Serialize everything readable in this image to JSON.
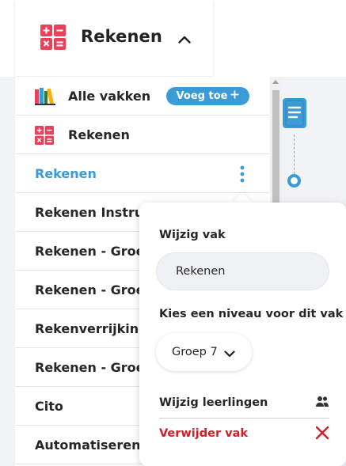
{
  "header": {
    "title": "Rekenen",
    "icon": "math-operators-icon",
    "toggle_icon": "chevron-up-icon"
  },
  "list": {
    "items": [
      {
        "label": "Alle vakken",
        "icon": "books-icon",
        "button": "Voeg toe"
      },
      {
        "label": "Rekenen",
        "icon": "math-operators-icon"
      },
      {
        "label": "Rekenen",
        "active": true,
        "menu_icon": "kebab-icon"
      },
      {
        "label": "Rekenen Instructie"
      },
      {
        "label": "Rekenen - Groep"
      },
      {
        "label": "Rekenen - Groep"
      },
      {
        "label": "Rekenverrijking"
      },
      {
        "label": "Rekenen - Groep"
      },
      {
        "label": "Cito"
      },
      {
        "label": "Automatiseren"
      }
    ]
  },
  "popup": {
    "edit_subject_label": "Wijzig vak",
    "subject_name_value": "Rekenen",
    "level_label": "Kies een niveau voor dit vak",
    "level_value": "Groep 7",
    "edit_students_label": "Wijzig leerlingen",
    "delete_label": "Verwijder vak"
  },
  "colors": {
    "accent": "#3b9bd6",
    "danger": "#cc2027",
    "math_icon": "#e8415a"
  }
}
